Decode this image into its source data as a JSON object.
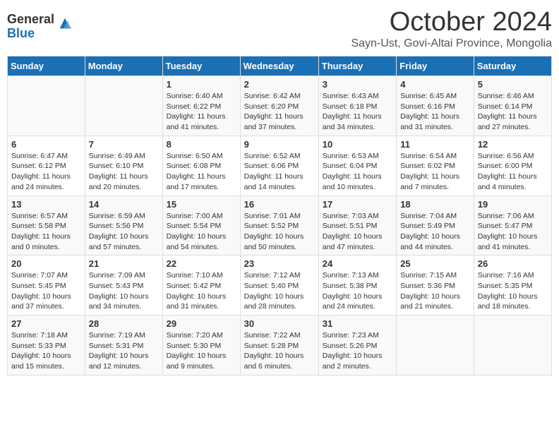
{
  "logo": {
    "general": "General",
    "blue": "Blue"
  },
  "title": "October 2024",
  "location": "Sayn-Ust, Govi-Altai Province, Mongolia",
  "headers": [
    "Sunday",
    "Monday",
    "Tuesday",
    "Wednesday",
    "Thursday",
    "Friday",
    "Saturday"
  ],
  "weeks": [
    [
      {
        "day": "",
        "content": ""
      },
      {
        "day": "",
        "content": ""
      },
      {
        "day": "1",
        "content": "Sunrise: 6:40 AM\nSunset: 6:22 PM\nDaylight: 11 hours and 41 minutes."
      },
      {
        "day": "2",
        "content": "Sunrise: 6:42 AM\nSunset: 6:20 PM\nDaylight: 11 hours and 37 minutes."
      },
      {
        "day": "3",
        "content": "Sunrise: 6:43 AM\nSunset: 6:18 PM\nDaylight: 11 hours and 34 minutes."
      },
      {
        "day": "4",
        "content": "Sunrise: 6:45 AM\nSunset: 6:16 PM\nDaylight: 11 hours and 31 minutes."
      },
      {
        "day": "5",
        "content": "Sunrise: 6:46 AM\nSunset: 6:14 PM\nDaylight: 11 hours and 27 minutes."
      }
    ],
    [
      {
        "day": "6",
        "content": "Sunrise: 6:47 AM\nSunset: 6:12 PM\nDaylight: 11 hours and 24 minutes."
      },
      {
        "day": "7",
        "content": "Sunrise: 6:49 AM\nSunset: 6:10 PM\nDaylight: 11 hours and 20 minutes."
      },
      {
        "day": "8",
        "content": "Sunrise: 6:50 AM\nSunset: 6:08 PM\nDaylight: 11 hours and 17 minutes."
      },
      {
        "day": "9",
        "content": "Sunrise: 6:52 AM\nSunset: 6:06 PM\nDaylight: 11 hours and 14 minutes."
      },
      {
        "day": "10",
        "content": "Sunrise: 6:53 AM\nSunset: 6:04 PM\nDaylight: 11 hours and 10 minutes."
      },
      {
        "day": "11",
        "content": "Sunrise: 6:54 AM\nSunset: 6:02 PM\nDaylight: 11 hours and 7 minutes."
      },
      {
        "day": "12",
        "content": "Sunrise: 6:56 AM\nSunset: 6:00 PM\nDaylight: 11 hours and 4 minutes."
      }
    ],
    [
      {
        "day": "13",
        "content": "Sunrise: 6:57 AM\nSunset: 5:58 PM\nDaylight: 11 hours and 0 minutes."
      },
      {
        "day": "14",
        "content": "Sunrise: 6:59 AM\nSunset: 5:56 PM\nDaylight: 10 hours and 57 minutes."
      },
      {
        "day": "15",
        "content": "Sunrise: 7:00 AM\nSunset: 5:54 PM\nDaylight: 10 hours and 54 minutes."
      },
      {
        "day": "16",
        "content": "Sunrise: 7:01 AM\nSunset: 5:52 PM\nDaylight: 10 hours and 50 minutes."
      },
      {
        "day": "17",
        "content": "Sunrise: 7:03 AM\nSunset: 5:51 PM\nDaylight: 10 hours and 47 minutes."
      },
      {
        "day": "18",
        "content": "Sunrise: 7:04 AM\nSunset: 5:49 PM\nDaylight: 10 hours and 44 minutes."
      },
      {
        "day": "19",
        "content": "Sunrise: 7:06 AM\nSunset: 5:47 PM\nDaylight: 10 hours and 41 minutes."
      }
    ],
    [
      {
        "day": "20",
        "content": "Sunrise: 7:07 AM\nSunset: 5:45 PM\nDaylight: 10 hours and 37 minutes."
      },
      {
        "day": "21",
        "content": "Sunrise: 7:09 AM\nSunset: 5:43 PM\nDaylight: 10 hours and 34 minutes."
      },
      {
        "day": "22",
        "content": "Sunrise: 7:10 AM\nSunset: 5:42 PM\nDaylight: 10 hours and 31 minutes."
      },
      {
        "day": "23",
        "content": "Sunrise: 7:12 AM\nSunset: 5:40 PM\nDaylight: 10 hours and 28 minutes."
      },
      {
        "day": "24",
        "content": "Sunrise: 7:13 AM\nSunset: 5:38 PM\nDaylight: 10 hours and 24 minutes."
      },
      {
        "day": "25",
        "content": "Sunrise: 7:15 AM\nSunset: 5:36 PM\nDaylight: 10 hours and 21 minutes."
      },
      {
        "day": "26",
        "content": "Sunrise: 7:16 AM\nSunset: 5:35 PM\nDaylight: 10 hours and 18 minutes."
      }
    ],
    [
      {
        "day": "27",
        "content": "Sunrise: 7:18 AM\nSunset: 5:33 PM\nDaylight: 10 hours and 15 minutes."
      },
      {
        "day": "28",
        "content": "Sunrise: 7:19 AM\nSunset: 5:31 PM\nDaylight: 10 hours and 12 minutes."
      },
      {
        "day": "29",
        "content": "Sunrise: 7:20 AM\nSunset: 5:30 PM\nDaylight: 10 hours and 9 minutes."
      },
      {
        "day": "30",
        "content": "Sunrise: 7:22 AM\nSunset: 5:28 PM\nDaylight: 10 hours and 6 minutes."
      },
      {
        "day": "31",
        "content": "Sunrise: 7:23 AM\nSunset: 5:26 PM\nDaylight: 10 hours and 2 minutes."
      },
      {
        "day": "",
        "content": ""
      },
      {
        "day": "",
        "content": ""
      }
    ]
  ]
}
